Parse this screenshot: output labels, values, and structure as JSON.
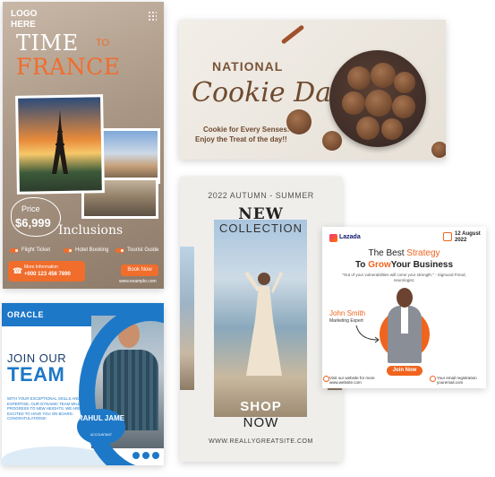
{
  "card_time_to_france": {
    "logo": "LOGO HERE",
    "title_time": "TIME",
    "title_to": "TO",
    "title_france": "FRANCE",
    "price_label": "Price",
    "price_value": "$6,999",
    "inclusions": "Inclusions",
    "features": [
      "Flight Ticket",
      "Hotel Booking",
      "Tourist Guide"
    ],
    "info_label": "More Information",
    "info_phone": "+000 123 456 7890",
    "book_button": "Book Now",
    "website": "www.example.com"
  },
  "card_cookie_day": {
    "national": "NATIONAL",
    "title": "Cookie Day",
    "subtitle_1": "Cookie for Every Senses.",
    "subtitle_2": "Enjoy the Treat of the day!!"
  },
  "card_new_collection": {
    "season": "2022 AUTUMN - SUMMER",
    "new": "NEW",
    "collection": "COLLECTION",
    "shop": "SHOP",
    "now": "NOW",
    "url": "WWW.REALLYGREATSITE.COM"
  },
  "card_business": {
    "brand": "Lazada",
    "date_day": "12 August",
    "date_year": "2022",
    "headline_1_plain": "The Best ",
    "headline_1_accent": "Strategy",
    "headline_2_a": "To ",
    "headline_2_accent": "Grow",
    "headline_2_b": "Your Business",
    "quote": "\"Out of your vulnerabilities will come your strength.\" - Sigmund Freud, neurologist.",
    "person_name": "John Smith",
    "person_role": "Marketing Expert",
    "join_button": "Join Now",
    "website_line_1": "Visit our website for more",
    "website_line_2": "www.website.com",
    "reg_line_1": "Your email registration",
    "reg_line_2": "youremail.com"
  },
  "card_join_team": {
    "brand": "ORACLE",
    "join": "JOIN OUR",
    "team": "TEAM",
    "description": "WITH YOUR EXCEPTIONAL SKILLS AND EXPERTISE, OUR DYNAMIC TEAM WILL PROGRESS TO NEW HEIGHTS. WE ARE EXCITED TO HAVE YOU ON BOARD. CONGRATULATIONS!",
    "name": "RAHUL JAME",
    "role": "ACCOUNTANT"
  },
  "colors": {
    "france_orange": "#f06d2c",
    "cookie_brown": "#6f4a2f",
    "business_orange": "#f0641e",
    "oracle_blue": "#1e78c8"
  }
}
